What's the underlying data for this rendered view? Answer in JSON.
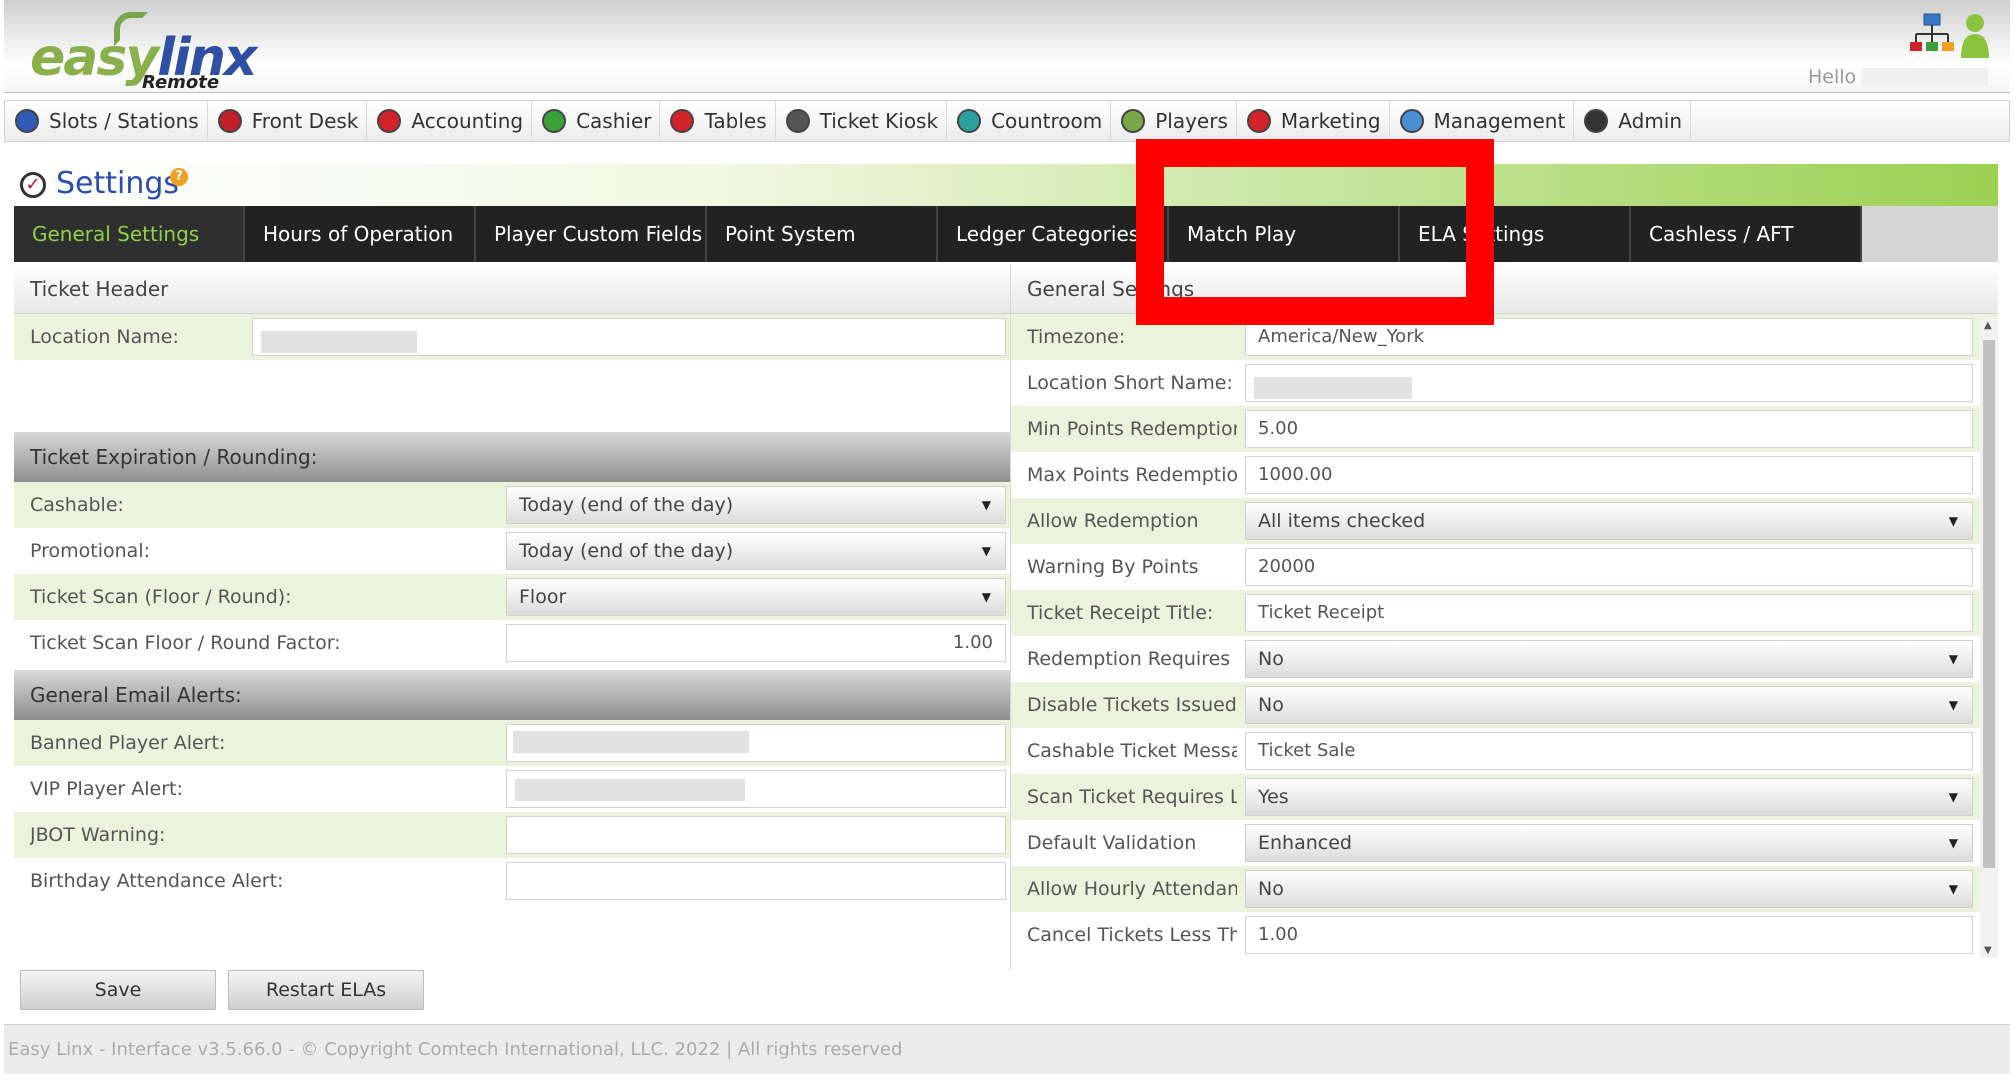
{
  "header": {
    "logo_easy": "easy",
    "logo_linx": "linx",
    "logo_remote": "Remote",
    "hello": "Hello",
    "network_icon": "network-icon",
    "user_icon": "user-icon"
  },
  "nav": {
    "items": [
      {
        "label": "Slots / Stations",
        "icon": "slots-icon",
        "color": "#2d5bb5"
      },
      {
        "label": "Front Desk",
        "icon": "front-desk-icon",
        "color": "#c0202a"
      },
      {
        "label": "Accounting",
        "icon": "accounting-icon",
        "color": "#d2222a"
      },
      {
        "label": "Cashier",
        "icon": "cashier-icon",
        "color": "#3aa03a"
      },
      {
        "label": "Tables",
        "icon": "tables-icon",
        "color": "#d2222a"
      },
      {
        "label": "Ticket Kiosk",
        "icon": "ticket-kiosk-icon",
        "color": "#555555"
      },
      {
        "label": "Countroom",
        "icon": "countroom-icon",
        "color": "#2aa0a0"
      },
      {
        "label": "Players",
        "icon": "players-icon",
        "color": "#7aa64a"
      },
      {
        "label": "Marketing",
        "icon": "marketing-icon",
        "color": "#d2222a"
      },
      {
        "label": "Management",
        "icon": "management-icon",
        "color": "#4a8fd2"
      },
      {
        "label": "Admin",
        "icon": "admin-gear-icon",
        "color": "#333333"
      }
    ]
  },
  "page": {
    "title": "Settings",
    "help": "?"
  },
  "tabs": [
    {
      "label": "General Settings",
      "active": true
    },
    {
      "label": "Hours of Operation",
      "active": false
    },
    {
      "label": "Player Custom Fields",
      "active": false
    },
    {
      "label": "Point System",
      "active": false
    },
    {
      "label": "Ledger Categories",
      "active": false
    },
    {
      "label": "Match Play",
      "active": false
    },
    {
      "label": "ELA Settings",
      "active": false
    },
    {
      "label": "Cashless / AFT",
      "active": false
    }
  ],
  "left": {
    "ticket_header": "Ticket Header",
    "location_name_label": "Location Name:",
    "expiration_header": "Ticket Expiration / Rounding:",
    "cashable_label": "Cashable:",
    "cashable_value": "Today (end of the day)",
    "promotional_label": "Promotional:",
    "promotional_value": "Today (end of the day)",
    "scan_label": "Ticket Scan (Floor / Round):",
    "scan_value": "Floor",
    "scan_factor_label": "Ticket Scan Floor / Round Factor:",
    "scan_factor_value": "1.00",
    "email_header": "General Email Alerts:",
    "banned_label": "Banned Player Alert:",
    "vip_label": "VIP Player Alert:",
    "jbot_label": "JBOT Warning:",
    "birthday_label": "Birthday Attendance Alert:"
  },
  "right": {
    "header": "General Settings",
    "rows": [
      {
        "label": "Timezone:",
        "value": "America/New_York",
        "type": "input"
      },
      {
        "label": "Location Short Name:",
        "value": "",
        "type": "input-blur"
      },
      {
        "label": "Min Points Redemption",
        "value": "5.00",
        "type": "input"
      },
      {
        "label": "Max Points Redemption",
        "value": "1000.00",
        "type": "input"
      },
      {
        "label": "Allow Redemption",
        "value": "All items checked",
        "type": "select"
      },
      {
        "label": "Warning By Points",
        "value": "20000",
        "type": "input"
      },
      {
        "label": "Ticket Receipt Title:",
        "value": "Ticket Receipt",
        "type": "input"
      },
      {
        "label": "Redemption Requires",
        "value": "No",
        "type": "select"
      },
      {
        "label": "Disable Tickets Issued",
        "value": "No",
        "type": "select"
      },
      {
        "label": "Cashable Ticket Message",
        "value": "Ticket Sale",
        "type": "input"
      },
      {
        "label": "Scan Ticket Requires L",
        "value": "Yes",
        "type": "select"
      },
      {
        "label": "Default Validation",
        "value": "Enhanced",
        "type": "select"
      },
      {
        "label": "Allow Hourly Attendance",
        "value": "No",
        "type": "select"
      },
      {
        "label": "Cancel Tickets Less Than",
        "value": "1.00",
        "type": "input"
      }
    ]
  },
  "buttons": {
    "save": "Save",
    "restart": "Restart ELAs"
  },
  "footer": {
    "text": "Easy Linx - Interface v3.5.66.0 - © Copyright Comtech International, LLC. 2022 | All rights reserved"
  },
  "colors": {
    "accent_green": "#8fd14a",
    "brand_blue": "#2a4db3",
    "highlight_red": "#ff0000"
  }
}
